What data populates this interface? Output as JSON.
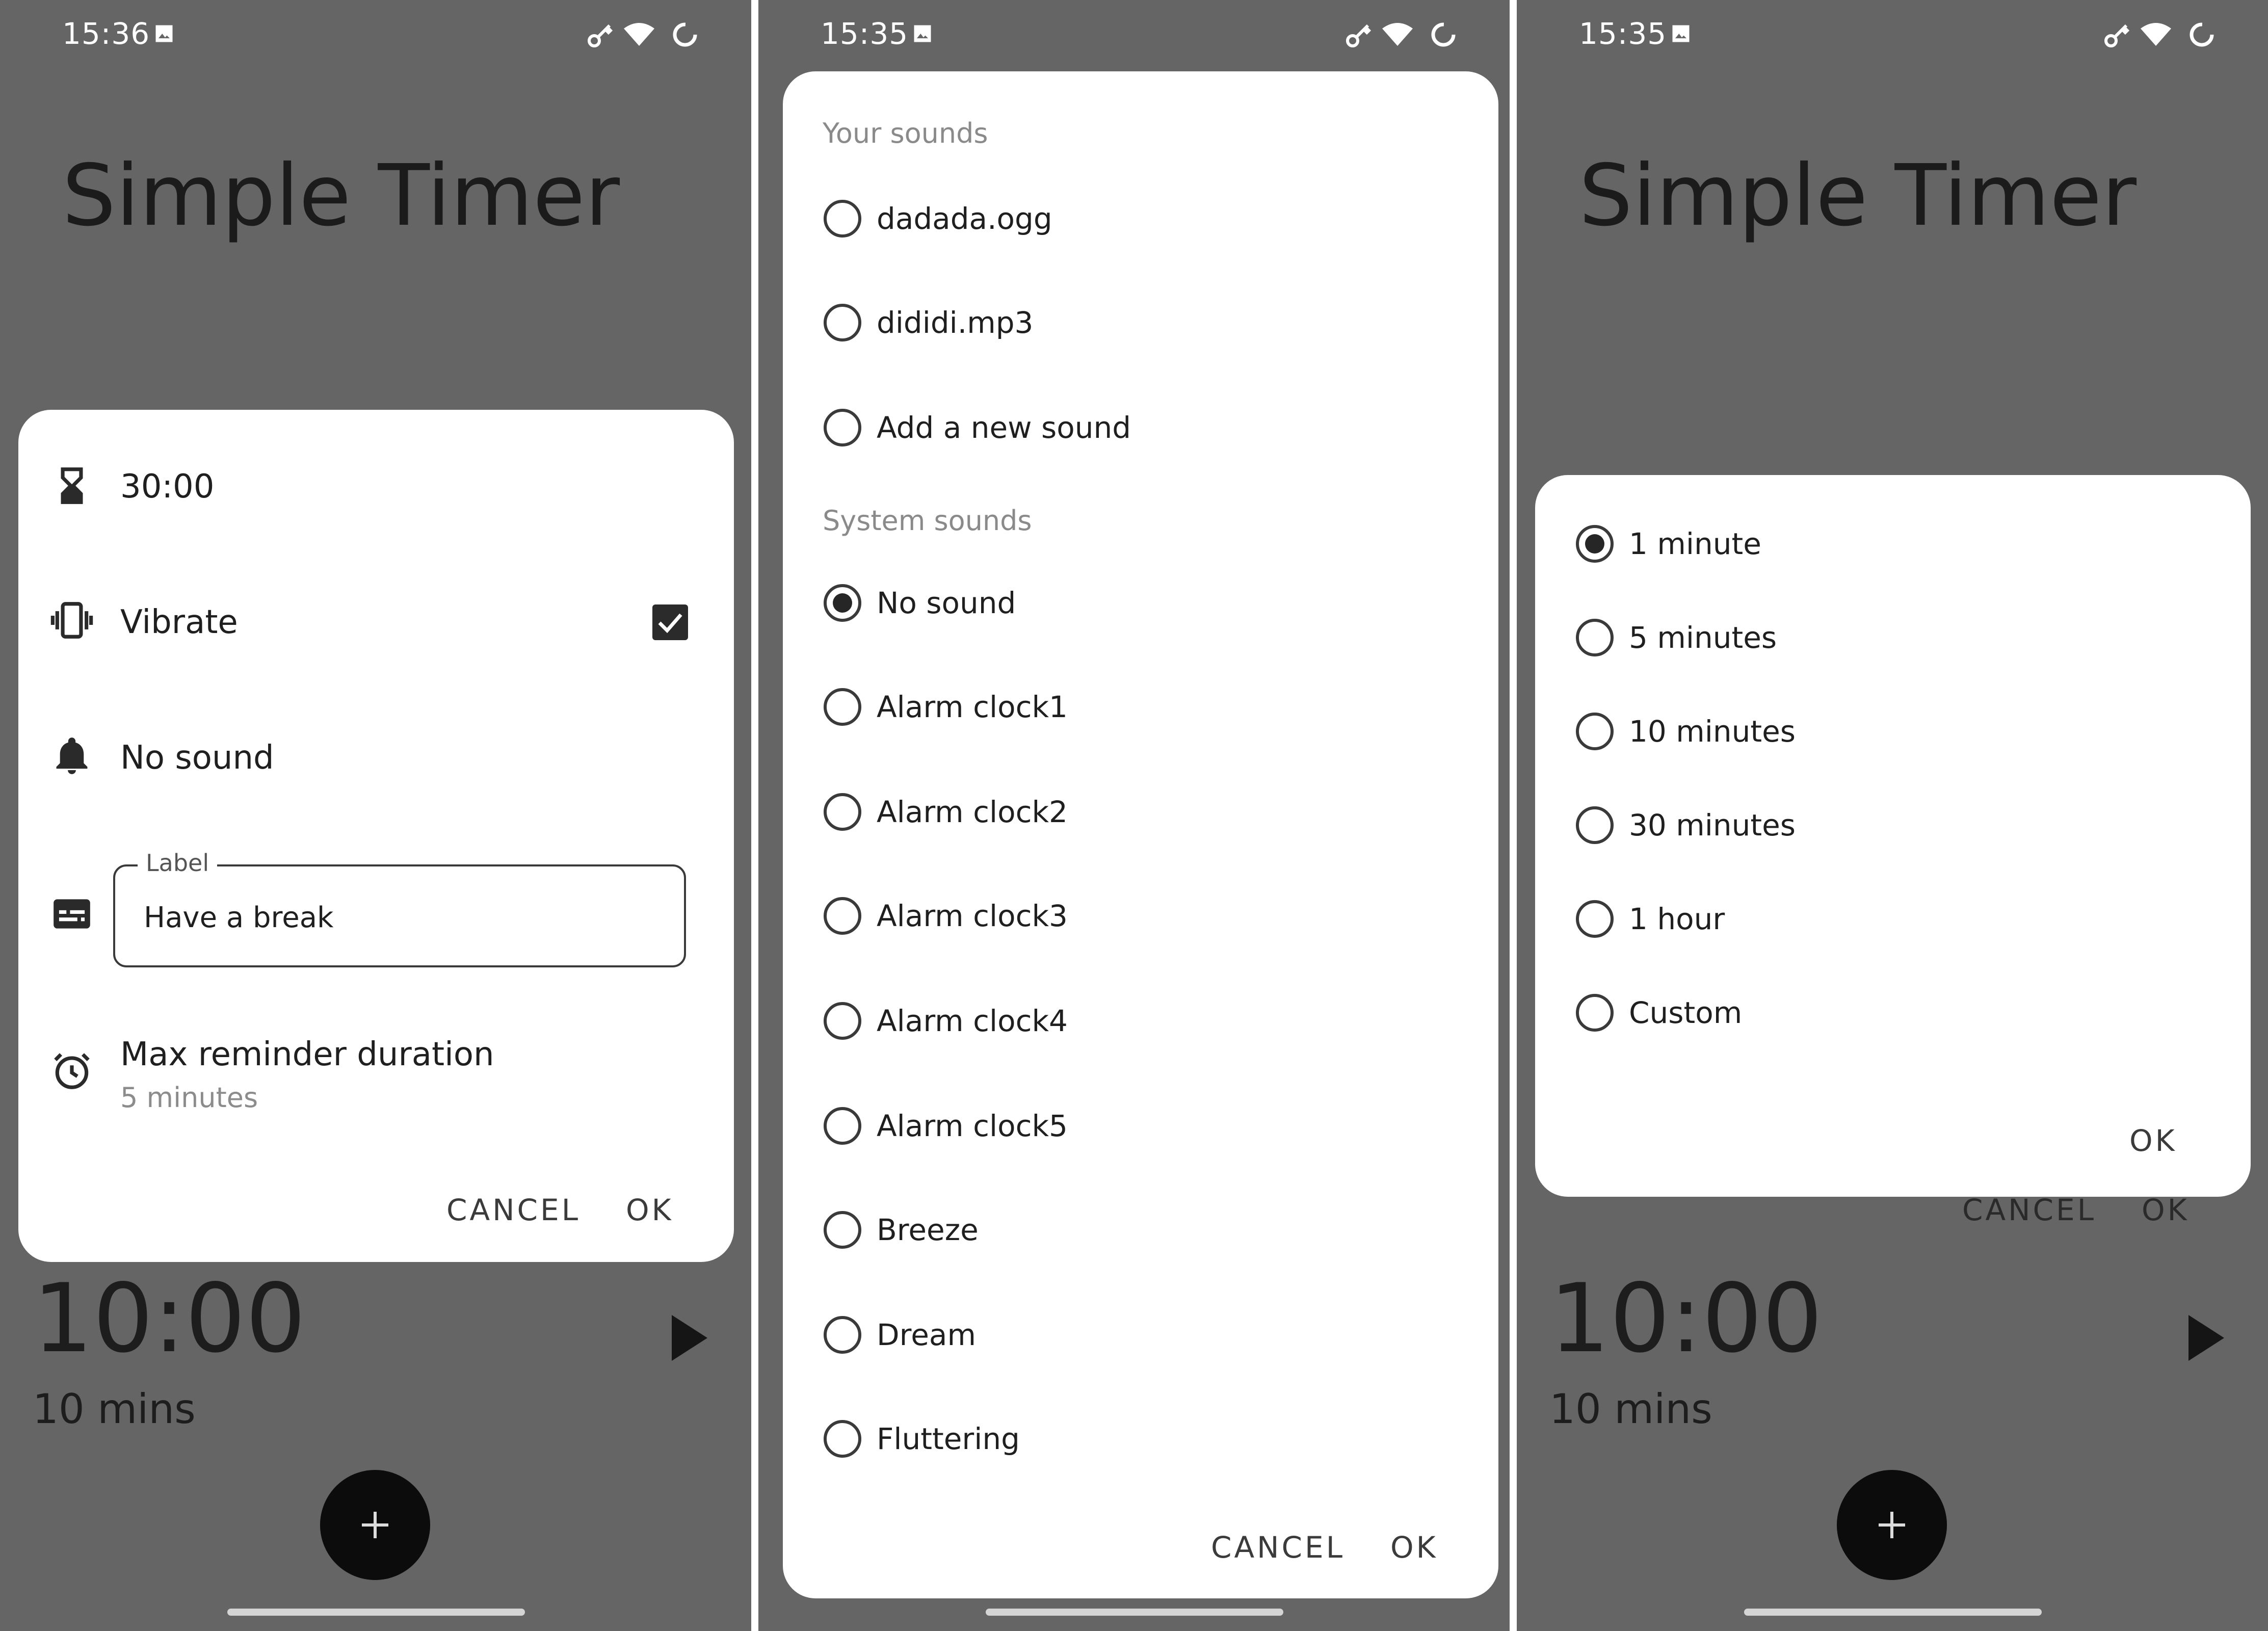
{
  "screens": [
    {
      "status": {
        "time": "15:36"
      },
      "app_title": "Simple Timer",
      "timer": {
        "time": "10:00",
        "subtitle": "10 mins"
      },
      "dialog": {
        "duration": "30:00",
        "vibrate_label": "Vibrate",
        "vibrate_checked": true,
        "sound": "No sound",
        "label_caption": "Label",
        "label_value": "Have a break",
        "reminder_title": "Max reminder duration",
        "reminder_value": "5 minutes",
        "cancel": "CANCEL",
        "ok": "OK"
      }
    },
    {
      "status": {
        "time": "15:35"
      },
      "dialog": {
        "your_sounds_header": "Your sounds",
        "your_sounds": [
          {
            "label": "dadada.ogg",
            "selected": false
          },
          {
            "label": "dididi.mp3",
            "selected": false
          },
          {
            "label": "Add a new sound",
            "selected": false
          }
        ],
        "system_sounds_header": "System sounds",
        "system_sounds": [
          {
            "label": "No sound",
            "selected": true
          },
          {
            "label": "Alarm clock1",
            "selected": false
          },
          {
            "label": "Alarm clock2",
            "selected": false
          },
          {
            "label": "Alarm clock3",
            "selected": false
          },
          {
            "label": "Alarm clock4",
            "selected": false
          },
          {
            "label": "Alarm clock5",
            "selected": false
          },
          {
            "label": "Breeze",
            "selected": false
          },
          {
            "label": "Dream",
            "selected": false
          },
          {
            "label": "Fluttering",
            "selected": false
          }
        ],
        "cancel": "CANCEL",
        "ok": "OK"
      }
    },
    {
      "status": {
        "time": "15:35"
      },
      "app_title": "Simple Timer",
      "timer": {
        "time": "10:00",
        "subtitle": "10 mins"
      },
      "behind_buttons": {
        "cancel": "CANCEL",
        "ok": "OK"
      },
      "dialog": {
        "options": [
          {
            "label": "1 minute",
            "selected": true
          },
          {
            "label": "5 minutes",
            "selected": false
          },
          {
            "label": "10 minutes",
            "selected": false
          },
          {
            "label": "30 minutes",
            "selected": false
          },
          {
            "label": "1 hour",
            "selected": false
          },
          {
            "label": "Custom",
            "selected": false
          }
        ],
        "ok": "OK"
      }
    }
  ],
  "colors": {
    "scrim": "#656565",
    "dialog": "#ffffff",
    "fab": "#0c0c0c",
    "text": "#1f1f1f"
  },
  "icons": [
    "image-icon",
    "vpn-key-icon",
    "wifi-icon",
    "loading-icon",
    "hourglass-icon",
    "vibration-icon",
    "bell-icon",
    "subtitles-icon",
    "alarm-clock-icon",
    "play-icon",
    "plus-icon"
  ]
}
